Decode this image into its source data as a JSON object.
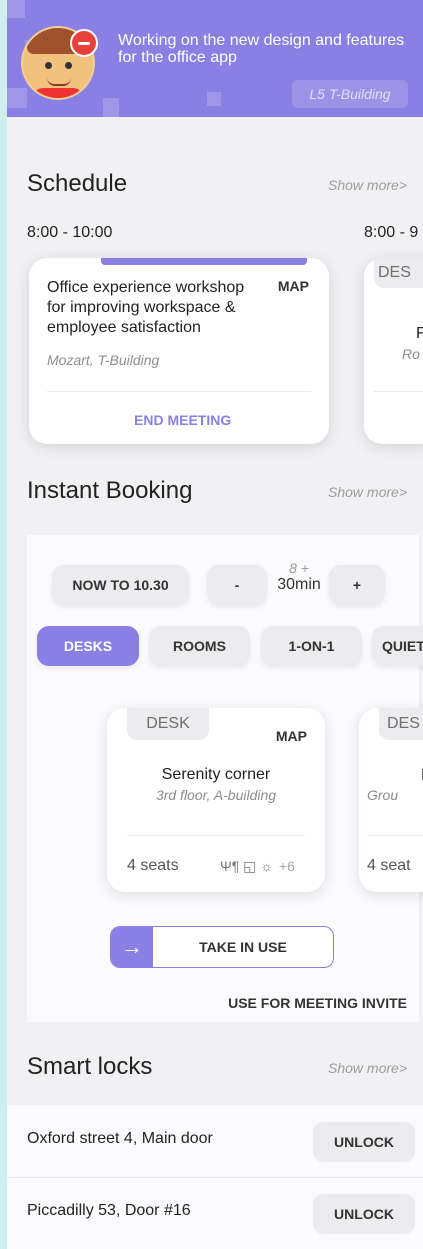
{
  "header": {
    "status_text": "Working on the new design and features for the office app",
    "location": "L5 T-Building"
  },
  "schedule": {
    "title": "Schedule",
    "show_more": "Show more>",
    "meetings": [
      {
        "time": "8:00 - 10:00",
        "title": "Office experience workshop for improving workspace & employee satisfaction",
        "map_label": "MAP",
        "location": "Mozart, T-Building",
        "action": "END MEETING"
      },
      {
        "time": "8:00 - 9",
        "tag": "DES",
        "title_partial": "F",
        "location_partial": "Ro"
      }
    ]
  },
  "instant_booking": {
    "title": "Instant Booking",
    "show_more": "Show more>",
    "time_button": "NOW TO 10.30",
    "minus": "-",
    "plus": "+",
    "duration_small": "8 +",
    "duration_big": "30min",
    "filters": [
      "DESKS",
      "ROOMS",
      "1-ON-1",
      "QUIET"
    ],
    "active_filter": "DESKS",
    "desks": [
      {
        "tag": "DESK",
        "map_label": "MAP",
        "name": "Serenity corner",
        "location": "3rd floor, A-building",
        "seats": "4 seats",
        "amenities": "Ψ¶ ◱ ☼",
        "more": "+6"
      },
      {
        "tag": "DES",
        "name_partial": "P",
        "location_partial": "Grou",
        "seats_partial": "4 seat"
      }
    ],
    "take_arrow": "→",
    "take_label": "TAKE IN USE",
    "invite_link": "USE FOR MEETING INVITE"
  },
  "smart_locks": {
    "title": "Smart locks",
    "show_more": "Show more>",
    "locks": [
      {
        "name": "Oxford street 4, Main door",
        "action": "UNLOCK"
      },
      {
        "name": "Piccadilly 53, Door #16",
        "action": "UNLOCK"
      }
    ]
  },
  "colors": {
    "accent": "#8a7fe3",
    "badge": "#e8413c",
    "background": "#f1f1f3"
  }
}
